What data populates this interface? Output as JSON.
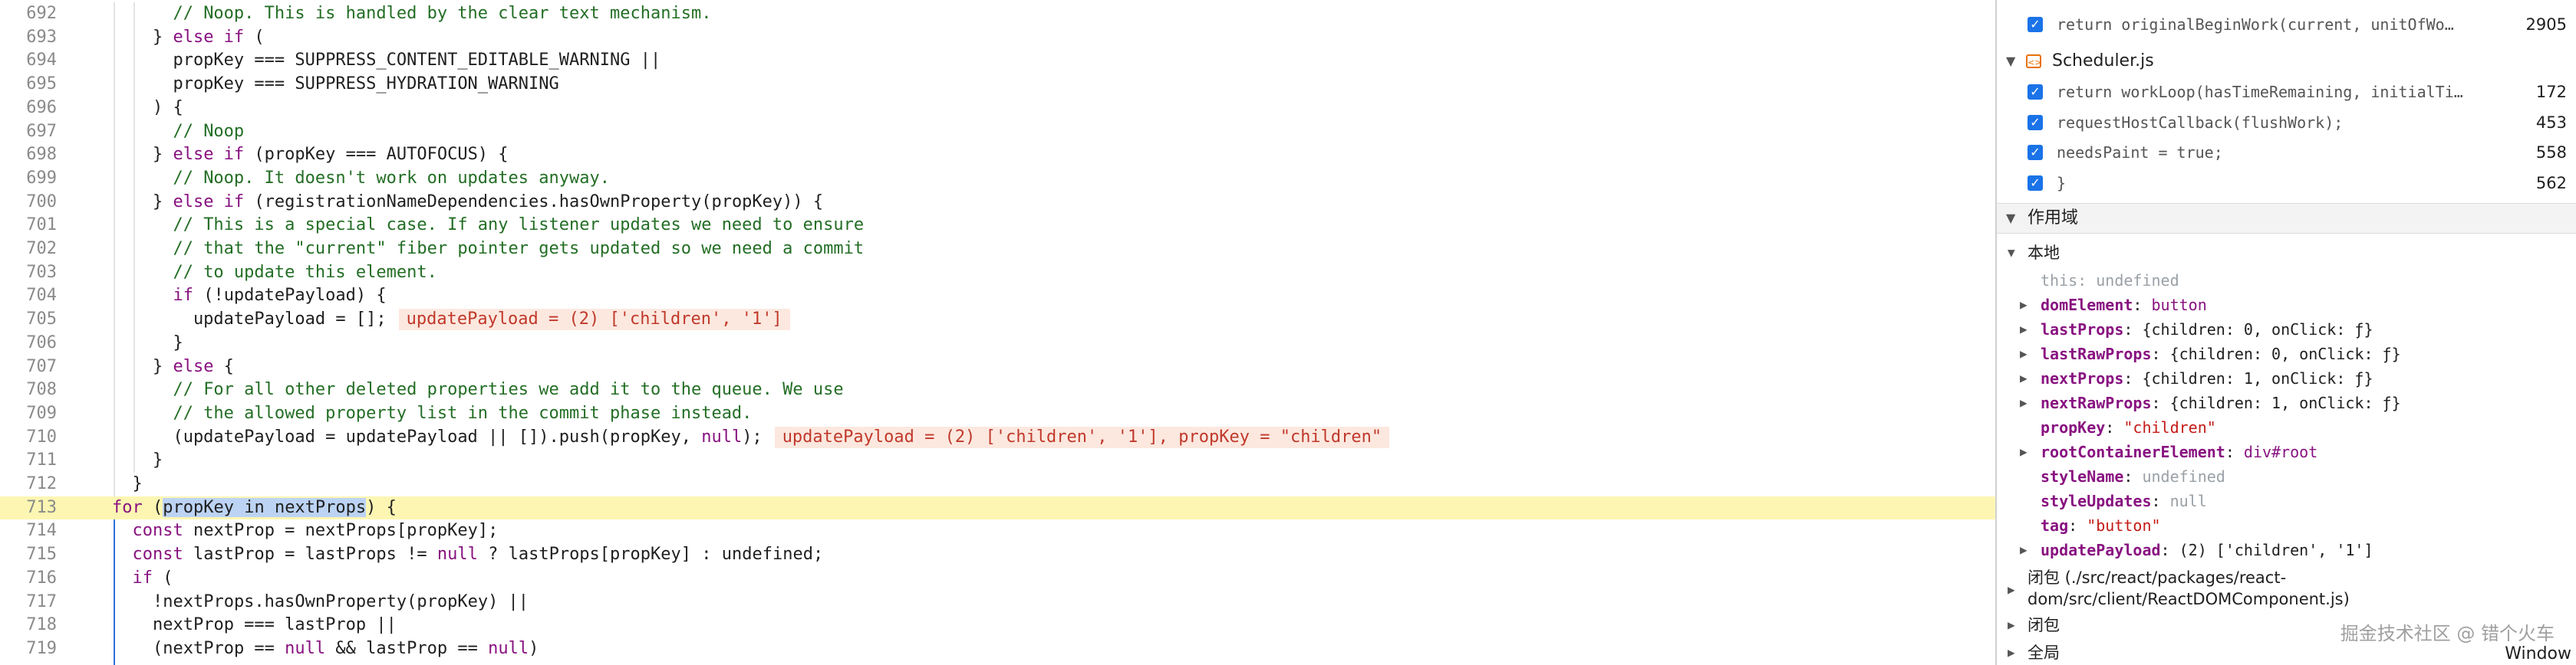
{
  "editor": {
    "paused_line": "713",
    "lines": [
      {
        "num": "692",
        "parts": [
          {
            "t": "    ",
            "c": ""
          },
          {
            "t": "// Noop. This is handled by the clear text mechanism.",
            "c": "cm"
          }
        ]
      },
      {
        "num": "693",
        "parts": [
          {
            "t": "  } ",
            "c": ""
          },
          {
            "t": "else if",
            "c": "kw"
          },
          {
            "t": " (",
            "c": ""
          }
        ]
      },
      {
        "num": "694",
        "parts": [
          {
            "t": "    propKey === SUPPRESS_CONTENT_EDITABLE_WARNING ||",
            "c": ""
          }
        ]
      },
      {
        "num": "695",
        "parts": [
          {
            "t": "    propKey === SUPPRESS_HYDRATION_WARNING",
            "c": ""
          }
        ]
      },
      {
        "num": "696",
        "parts": [
          {
            "t": "  ) {",
            "c": ""
          }
        ]
      },
      {
        "num": "697",
        "parts": [
          {
            "t": "    ",
            "c": ""
          },
          {
            "t": "// Noop",
            "c": "cm"
          }
        ]
      },
      {
        "num": "698",
        "parts": [
          {
            "t": "  } ",
            "c": ""
          },
          {
            "t": "else if",
            "c": "kw"
          },
          {
            "t": " (propKey === AUTOFOCUS) {",
            "c": ""
          }
        ]
      },
      {
        "num": "699",
        "parts": [
          {
            "t": "    ",
            "c": ""
          },
          {
            "t": "// Noop. It doesn't work on updates anyway.",
            "c": "cm"
          }
        ]
      },
      {
        "num": "700",
        "parts": [
          {
            "t": "  } ",
            "c": ""
          },
          {
            "t": "else if",
            "c": "kw"
          },
          {
            "t": " (registrationNameDependencies.hasOwnProperty(propKey)) {",
            "c": ""
          }
        ]
      },
      {
        "num": "701",
        "parts": [
          {
            "t": "    ",
            "c": ""
          },
          {
            "t": "// This is a special case. If any listener updates we need to ensure",
            "c": "cm"
          }
        ]
      },
      {
        "num": "702",
        "parts": [
          {
            "t": "    ",
            "c": ""
          },
          {
            "t": "// that the \"current\" fiber pointer gets updated so we need a commit",
            "c": "cm"
          }
        ]
      },
      {
        "num": "703",
        "parts": [
          {
            "t": "    ",
            "c": ""
          },
          {
            "t": "// to update this element.",
            "c": "cm"
          }
        ]
      },
      {
        "num": "704",
        "parts": [
          {
            "t": "    ",
            "c": ""
          },
          {
            "t": "if",
            "c": "kw"
          },
          {
            "t": " (!updatePayload) {",
            "c": ""
          }
        ]
      },
      {
        "num": "705",
        "parts": [
          {
            "t": "      updatePayload = [];",
            "c": ""
          }
        ],
        "inline": "updatePayload = (2) ['children', '1']"
      },
      {
        "num": "706",
        "parts": [
          {
            "t": "    }",
            "c": ""
          }
        ]
      },
      {
        "num": "707",
        "parts": [
          {
            "t": "  } ",
            "c": ""
          },
          {
            "t": "else",
            "c": "kw"
          },
          {
            "t": " {",
            "c": ""
          }
        ]
      },
      {
        "num": "708",
        "parts": [
          {
            "t": "    ",
            "c": ""
          },
          {
            "t": "// For all other deleted properties we add it to the queue. We use",
            "c": "cm"
          }
        ]
      },
      {
        "num": "709",
        "parts": [
          {
            "t": "    ",
            "c": ""
          },
          {
            "t": "// the allowed property list in the commit phase instead.",
            "c": "cm"
          }
        ]
      },
      {
        "num": "710",
        "parts": [
          {
            "t": "    (updatePayload = updatePayload || []).push(propKey, ",
            "c": ""
          },
          {
            "t": "null",
            "c": "kw"
          },
          {
            "t": ");",
            "c": ""
          }
        ],
        "inline": "updatePayload = (2) ['children', '1'], propKey = \"children\""
      },
      {
        "num": "711",
        "parts": [
          {
            "t": "  }",
            "c": ""
          }
        ]
      },
      {
        "num": "712",
        "parts": [
          {
            "t": "}",
            "c": ""
          }
        ]
      },
      {
        "num": "713",
        "parts": [
          {
            "t": "for",
            "c": "kw"
          },
          {
            "t": " (",
            "c": ""
          },
          {
            "t": "propKey in nextProps",
            "c": "sel"
          },
          {
            "t": ") {",
            "c": ""
          }
        ]
      },
      {
        "num": "714",
        "parts": [
          {
            "t": "  ",
            "c": ""
          },
          {
            "t": "const",
            "c": "kw"
          },
          {
            "t": " nextProp = nextProps[propKey];",
            "c": ""
          }
        ]
      },
      {
        "num": "715",
        "parts": [
          {
            "t": "  ",
            "c": ""
          },
          {
            "t": "const",
            "c": "kw"
          },
          {
            "t": " lastProp = lastProps != ",
            "c": ""
          },
          {
            "t": "null",
            "c": "kw"
          },
          {
            "t": " ? lastProps[propKey] : undefined;",
            "c": ""
          }
        ]
      },
      {
        "num": "716",
        "parts": [
          {
            "t": "  ",
            "c": ""
          },
          {
            "t": "if",
            "c": "kw"
          },
          {
            "t": " (",
            "c": ""
          }
        ]
      },
      {
        "num": "717",
        "parts": [
          {
            "t": "    !nextProps.hasOwnProperty(propKey) ||",
            "c": ""
          }
        ]
      },
      {
        "num": "718",
        "parts": [
          {
            "t": "    nextProp === lastProp ||",
            "c": ""
          }
        ]
      },
      {
        "num": "719",
        "parts": [
          {
            "t": "    (nextProp == ",
            "c": ""
          },
          {
            "t": "null",
            "c": "kw"
          },
          {
            "t": " && lastProp == ",
            "c": ""
          },
          {
            "t": "null",
            "c": "kw"
          },
          {
            "t": ")",
            "c": ""
          }
        ]
      }
    ]
  },
  "breakpoints": {
    "top_item": {
      "text": "return originalBeginWork(current, unitOfWo…",
      "line": "2905"
    },
    "file": {
      "name": "Scheduler.js",
      "icon": "js-file-icon"
    },
    "items": [
      {
        "text": "return workLoop(hasTimeRemaining, initialTim…",
        "line": "172"
      },
      {
        "text": "requestHostCallback(flushWork);",
        "line": "453"
      },
      {
        "text": "needsPaint = true;",
        "line": "558"
      },
      {
        "text": "}",
        "line": "562"
      }
    ]
  },
  "scope": {
    "header": "作用域",
    "local_label": "本地",
    "vars": [
      {
        "name": "this",
        "value": "undefined",
        "kind": "dim",
        "expandable": false,
        "dim_name": true
      },
      {
        "name": "domElement",
        "value": "button",
        "kind": "node",
        "expandable": true
      },
      {
        "name": "lastProps",
        "value": "{children: 0, onClick: ƒ}",
        "kind": "obj",
        "expandable": true
      },
      {
        "name": "lastRawProps",
        "value": "{children: 0, onClick: ƒ}",
        "kind": "obj",
        "expandable": true
      },
      {
        "name": "nextProps",
        "value": "{children: 1, onClick: ƒ}",
        "kind": "obj",
        "expandable": true
      },
      {
        "name": "nextRawProps",
        "value": "{children: 1, onClick: ƒ}",
        "kind": "obj",
        "expandable": true
      },
      {
        "name": "propKey",
        "value": "\"children\"",
        "kind": "str",
        "expandable": false
      },
      {
        "name": "rootContainerElement",
        "value": "div#root",
        "kind": "node",
        "expandable": true
      },
      {
        "name": "styleName",
        "value": "undefined",
        "kind": "dim",
        "expandable": false
      },
      {
        "name": "styleUpdates",
        "value": "null",
        "kind": "dim",
        "expandable": false
      },
      {
        "name": "tag",
        "value": "\"button\"",
        "kind": "str",
        "expandable": false
      },
      {
        "name": "updatePayload",
        "value": "(2) ['children', '1']",
        "kind": "arr",
        "expandable": true
      }
    ],
    "closure_label": "闭包 (./src/react/packages/react-",
    "closure_label_2": "dom/src/client/ReactDOMComponent.js)",
    "closure2_label": "闭包",
    "global_label": "全局",
    "global_value": "Window"
  },
  "watermark": "掘金技术社区 @ 错个火车"
}
